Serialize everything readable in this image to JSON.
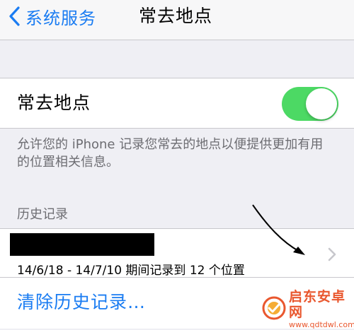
{
  "nav": {
    "back_label": "系统服务",
    "title": "常去地点"
  },
  "frequent_locations": {
    "label": "常去地点",
    "enabled": true,
    "switch_color": "#4cd964",
    "footer": "允许您的 iPhone 记录您常去的地点以便提供更加有用的位置相关信息。"
  },
  "history": {
    "header": "历史记录",
    "row_detail": "14/6/18 - 14/7/10 期间记录到 12 个位置",
    "clear_label": "清除历史记录…"
  },
  "watermark": {
    "name": "启东安卓网",
    "url": "www.qdtdwl.com"
  },
  "colors": {
    "accent": "#1a7cf2",
    "background": "#efeff4",
    "secondary_text": "#6d6d72"
  }
}
